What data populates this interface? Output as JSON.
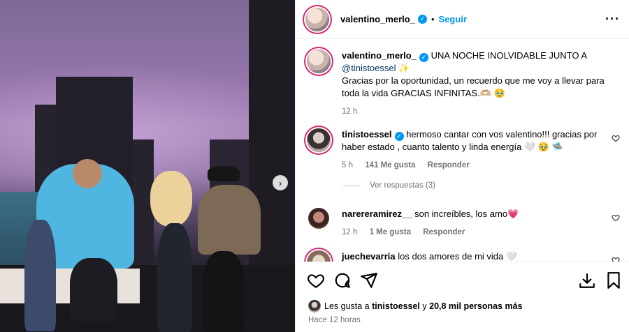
{
  "post": {
    "author": "valentino_merlo_",
    "follow_label": "Seguir",
    "separator": "•",
    "caption_line1": "UNA NOCHE INOLVIDABLE JUNTO A",
    "caption_mention": "@tinistoessel",
    "caption_emoji": "✨",
    "caption_body": "Gracias por la oportunidad, un recuerdo que me voy a llevar para toda la vida GRACIAS INFINITAS.🫶🏼 🥹",
    "caption_time": "12 h"
  },
  "comments": [
    {
      "user": "tinistoessel",
      "text": "hermoso cantar con vos valentino!!! gracias por haber estado , cuanto talento y linda energía 🤍 🥹 🛸",
      "time": "5 h",
      "likes": "141 Me gusta",
      "reply": "Responder",
      "view_replies": "Ver respuestas (3)"
    },
    {
      "user": "narereramirez__",
      "text": "son increíbles, los amo💗",
      "time": "12 h",
      "likes": "1 Me gusta",
      "reply": "Responder"
    },
    {
      "user": "juechevarria",
      "text": "los dos amores de mi vida 🤍"
    }
  ],
  "footer": {
    "liked_by_prefix": "Les gusta a",
    "liked_by_user": "tinistoessel",
    "liked_by_suffix": "y",
    "liked_by_others": "20,8 mil personas más",
    "posted": "Hace 12 horas"
  },
  "icons": {
    "like": "heart-icon",
    "comment": "comment-icon",
    "share": "share-icon",
    "save": "bookmark-icon",
    "download": "download-icon",
    "more": "more-icon"
  },
  "colors": {
    "accent": "#0095f6",
    "verified": "#0095f6",
    "muted": "#737373"
  }
}
